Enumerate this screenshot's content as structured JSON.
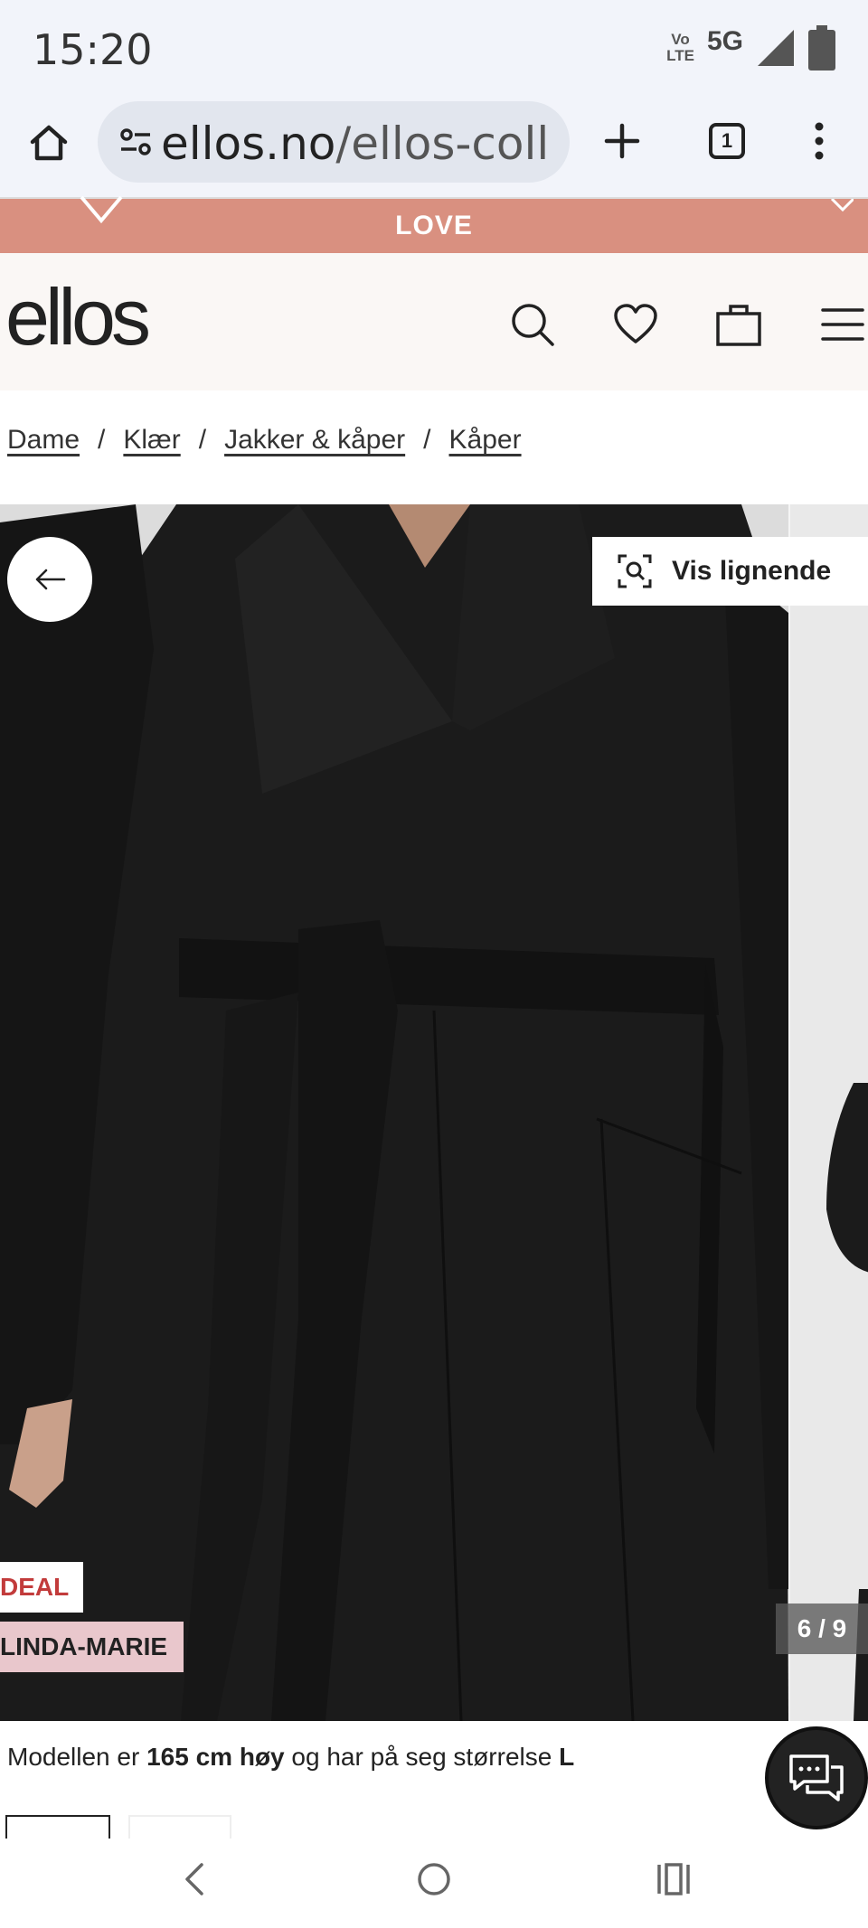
{
  "status": {
    "time": "15:20",
    "volte_top": "Vo",
    "volte_bottom": "LTE",
    "network": "5G"
  },
  "browser": {
    "url_domain": "ellos.no",
    "url_path": "/ellos-coll",
    "tab_count": "1"
  },
  "promo": {
    "text": "LOVE"
  },
  "header": {
    "logo": "ellos"
  },
  "breadcrumb": {
    "items": [
      "Dame",
      "Klær",
      "Jakker & kåper",
      "Kåper"
    ],
    "separator": "/"
  },
  "product": {
    "vis_lignende": "Vis lignende",
    "tag_deal": "DEAL",
    "tag_designer": "LINDA-MARIE",
    "image_counter": "6 / 9"
  },
  "caption": {
    "pre": "Modellen er ",
    "height": "165 cm høy",
    "mid": " og har på seg størrelse ",
    "size": "L"
  },
  "colors": {
    "promo": "#d99080",
    "header_bg": "#faf7f5",
    "deal_red": "#c23b3b",
    "designer_pink": "#e9c7cc",
    "coat": "#1a1a1a"
  }
}
